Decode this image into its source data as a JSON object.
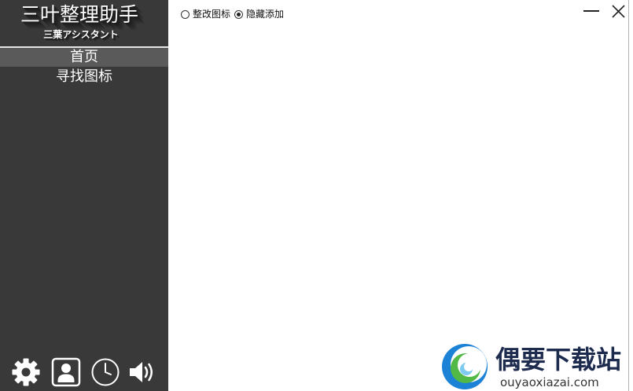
{
  "colors": {
    "sidebar_bg": "#393939",
    "nav_active_bg": "#5a5a5a",
    "sidebar_text": "#ffffff",
    "watermark_text": "#1d2b4f"
  },
  "window": {
    "minimize_icon": "minimize-icon",
    "close_icon": "close-icon"
  },
  "sidebar": {
    "logo": {
      "title": "三叶整理助手",
      "subtitle": "三葉アシスタント"
    },
    "nav": [
      {
        "label": "首页",
        "active": true
      },
      {
        "label": "寻找图标",
        "active": false
      }
    ],
    "footer_icons": [
      "gear-icon",
      "contact-card-icon",
      "clock-icon",
      "speaker-icon"
    ]
  },
  "main": {
    "options": [
      {
        "label": "整改图标",
        "checked": false
      },
      {
        "label": "隐藏添加",
        "checked": true
      }
    ]
  },
  "watermark": {
    "name": "偶要下载站",
    "url": "ouyaoxiazai.com",
    "logo_icon": "swirl-logo-icon"
  }
}
